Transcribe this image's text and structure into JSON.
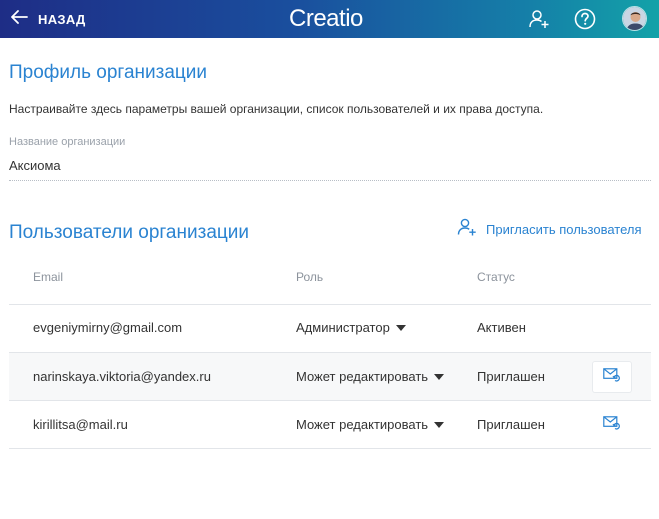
{
  "topbar": {
    "back_label": "НАЗАД",
    "logo_text": "Creatio",
    "icons": [
      "add-user-icon",
      "help-icon",
      "user-avatar"
    ],
    "gradient_start": "#1e2d86",
    "gradient_end": "#13a2a8"
  },
  "profile": {
    "title": "Профиль организации",
    "description": "Настраивайте здесь параметры вашей организации, список пользователей и их права доступа.",
    "org_name_label": "Название организации",
    "org_name_value": "Аксиома"
  },
  "users": {
    "title": "Пользователи организации",
    "invite_label": "Пригласить пользователя",
    "columns": {
      "email": "Email",
      "role": "Роль",
      "status": "Статус"
    },
    "rows": [
      {
        "email": "evgeniymirny@gmail.com",
        "role": "Администратор",
        "status": "Активен",
        "resend_icon": false
      },
      {
        "email": "narinskaya.viktoria@yandex.ru",
        "role": "Может редактировать",
        "status": "Приглашен",
        "resend_icon": true
      },
      {
        "email": "kirillitsa@mail.ru",
        "role": "Может редактировать",
        "status": "Приглашен",
        "resend_icon": true
      }
    ]
  },
  "colors": {
    "accent": "#2a83d1",
    "text": "#333333",
    "muted": "#8c939c"
  }
}
